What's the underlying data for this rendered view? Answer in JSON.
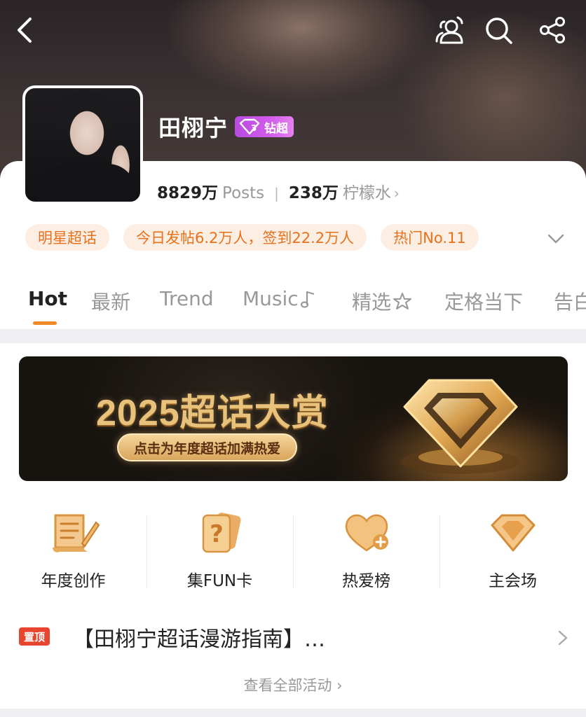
{
  "header": {
    "icons": [
      "back-icon",
      "people-icon",
      "search-icon",
      "share-icon"
    ]
  },
  "profile": {
    "title": "田栩宁",
    "badge_label": "钻超",
    "posts_count": "8829万",
    "posts_label": "Posts",
    "fans_count": "238万",
    "fans_label": "柠檬水"
  },
  "tags": [
    "明星超话",
    "今日发帖6.2万人，签到22.2万人",
    "热门No.11"
  ],
  "tabs": [
    "Hot",
    "最新",
    "Trend",
    "Music",
    "精选",
    "定格当下",
    "告白"
  ],
  "active_tab": "Hot",
  "banner": {
    "title": "2025超话大赏",
    "button": "点击为年度超话加满热爱"
  },
  "grid": [
    {
      "label": "年度创作",
      "icon": "scroll-pen-icon"
    },
    {
      "label": "集FUN卡",
      "icon": "question-cards-icon"
    },
    {
      "label": "热爱榜",
      "icon": "heart-plus-icon"
    },
    {
      "label": "主会场",
      "icon": "diamond-icon"
    }
  ],
  "pinned": {
    "tag": "置顶",
    "text": "【田栩宁超话漫游指南】…"
  },
  "view_all": "查看全部活动",
  "colors": {
    "accent": "#f08a2b",
    "tag_bg": "#fdeee3",
    "tag_text": "#e8721c",
    "badge": "#c24fe3",
    "pin": "#e8452f"
  }
}
